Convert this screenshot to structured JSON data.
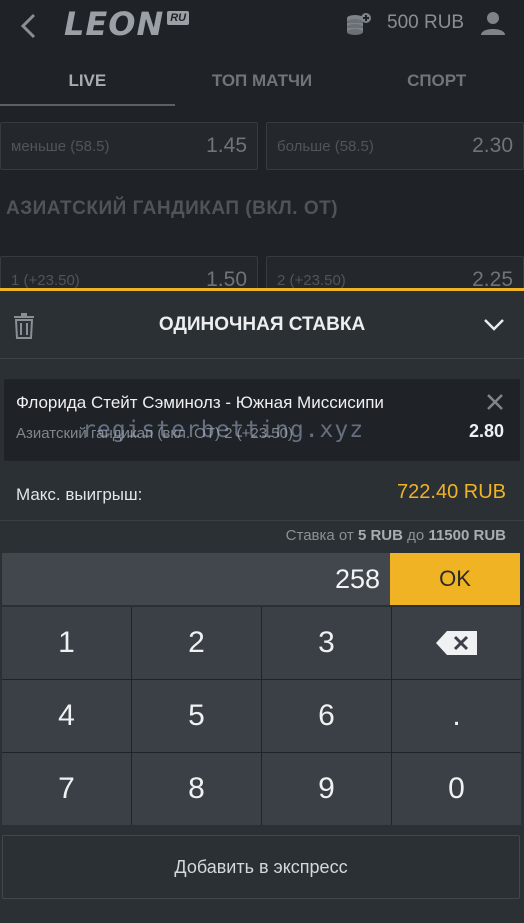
{
  "header": {
    "logo_text": "LEON",
    "logo_badge": "RU",
    "balance": "500 RUB"
  },
  "tabs": [
    {
      "label": "LIVE",
      "active": true
    },
    {
      "label": "ТОП МАТЧИ",
      "active": false
    },
    {
      "label": "СПОРТ",
      "active": false
    }
  ],
  "background_market": {
    "row1": [
      {
        "label": "меньше (58.5)",
        "value": "1.45"
      },
      {
        "label": "больше (58.5)",
        "value": "2.30"
      }
    ],
    "section_title": "АЗИАТСКИЙ ГАНДИКАП (ВКЛ. ОТ)",
    "row2": [
      {
        "label": "1 (+23.50)",
        "value": "1.50"
      },
      {
        "label": "2 (+23.50)",
        "value": "2.25"
      }
    ]
  },
  "bet_slip": {
    "title": "ОДИНОЧНАЯ СТАВКА",
    "match": "Флорида Стейт Сэминолз - Южная Миссисипи",
    "market": "Азиатский гандикап (вкл. ОТ) 2 (+23.50)",
    "odds": "2.80",
    "watermark": "registerbetting.xyz",
    "max_win_label": "Макс. выигрыш:",
    "max_win_value": "722.40 RUB",
    "stake_prefix": "Ставка от",
    "stake_min": "5 RUB",
    "stake_mid": "до",
    "stake_max": "11500 RUB",
    "amount": "258",
    "ok_label": "OK",
    "express_label": "Добавить в экспресс"
  },
  "keypad": {
    "k1": "1",
    "k2": "2",
    "k3": "3",
    "k4": "4",
    "k5": "5",
    "k6": "6",
    "kdot": ".",
    "k7": "7",
    "k8": "8",
    "k9": "9",
    "k0": "0"
  },
  "colors": {
    "accent": "#f0b323",
    "background": "#2b3035",
    "page_dim": "#1f2327"
  }
}
